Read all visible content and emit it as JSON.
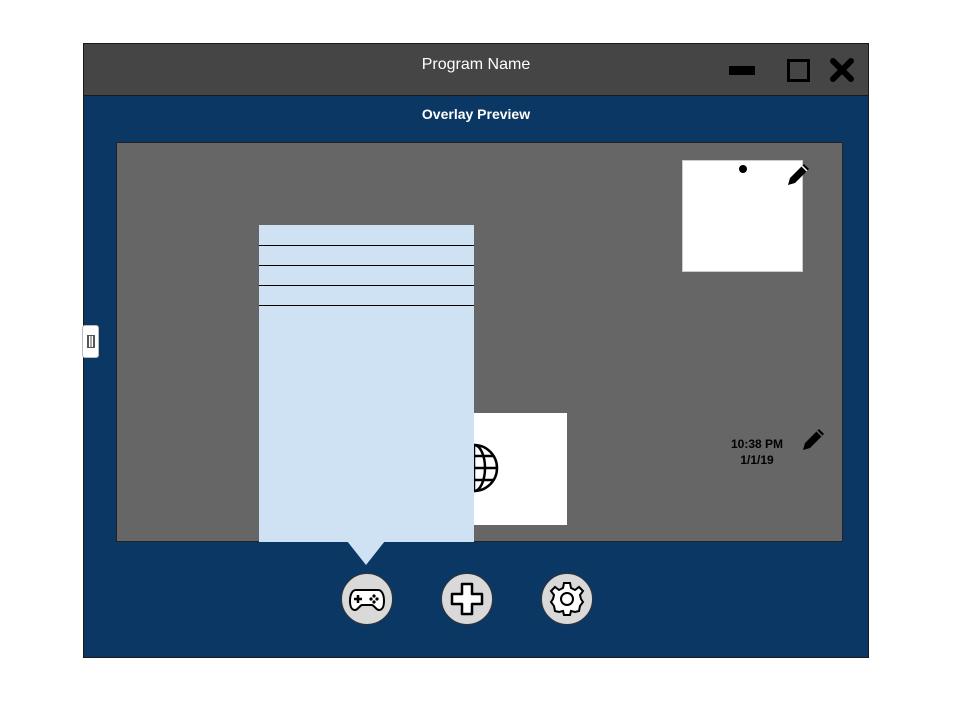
{
  "window": {
    "title": "Program Name",
    "controls": [
      "minimize-icon",
      "maximize-icon",
      "close-icon"
    ]
  },
  "overlay": {
    "label": "Overlay Preview"
  },
  "clock": {
    "time": "10:38 PM",
    "date": "1/1/19"
  },
  "menu": {
    "rows": 4
  },
  "toolbar": {
    "buttons": [
      "gamepad-icon",
      "plus-icon",
      "gear-icon"
    ]
  },
  "colors": {
    "window_bg": "#0b3764",
    "titlebar": "#454545",
    "preview_bg": "#666666",
    "menu_bg": "#cfe2f3"
  }
}
